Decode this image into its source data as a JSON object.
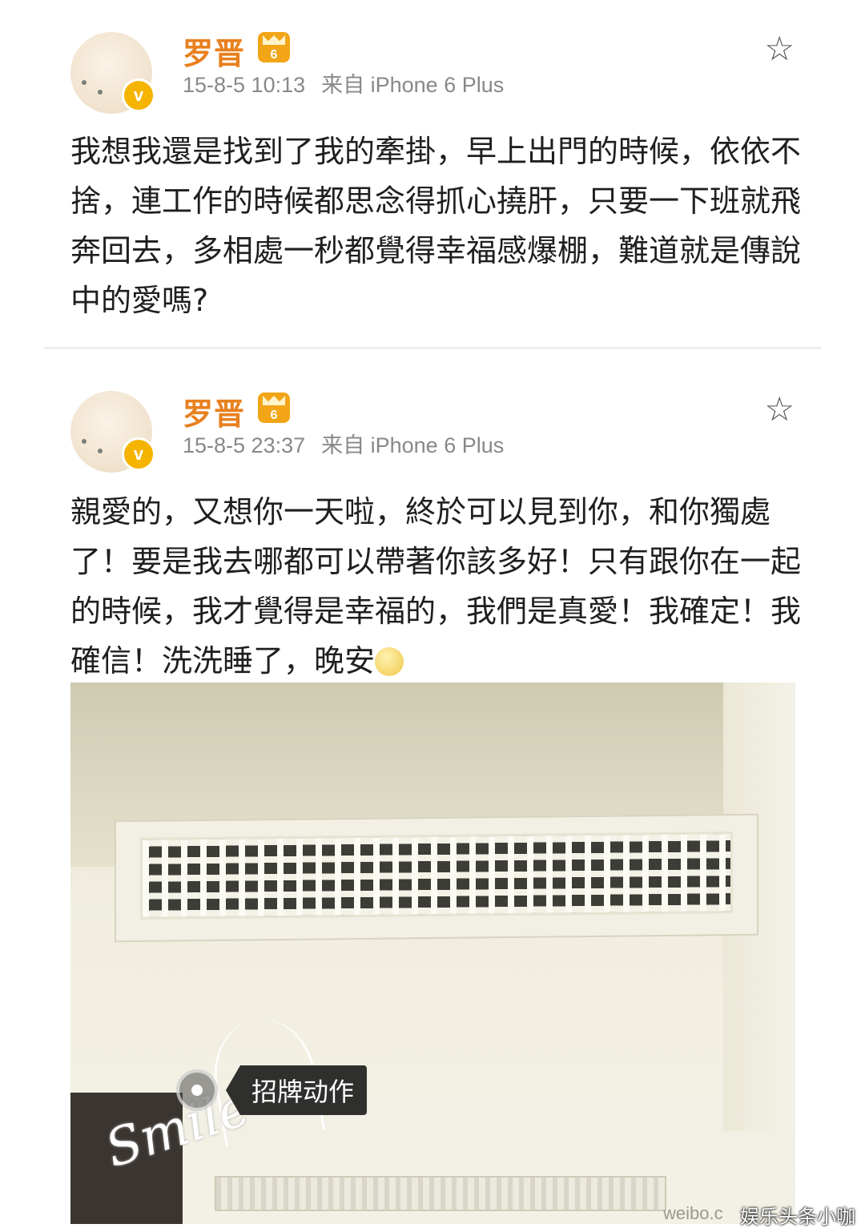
{
  "posts": [
    {
      "username": "罗晋",
      "level_badge": "6",
      "verified_badge": "v",
      "time": "15-8-5 10:13",
      "source": "来自 iPhone 6 Plus",
      "text": "我想我還是找到了我的牽掛，早上出門的時候，依依不捨，連工作的時候都思念得抓心撓肝，只要一下班就飛奔回去，多相處一秒都覺得幸福感爆棚，難道就是傳說中的愛嗎?"
    },
    {
      "username": "罗晋",
      "level_badge": "6",
      "verified_badge": "v",
      "time": "15-8-5 23:37",
      "source": "来自 iPhone 6 Plus",
      "text": "親愛的，又想你一天啦，終於可以見到你，和你獨處了！要是我去哪都可以帶著你該多好！只有跟你在一起的時候，我才覺得是幸福的，我們是真愛！我確定！我確信！洗洗睡了，晚安",
      "photo": {
        "tag_label": "招牌动作",
        "sticker_text": "Smile",
        "watermark": "weibo.c"
      }
    }
  ],
  "corner_watermark": "娱乐头条小咖",
  "icons": {
    "favorite": "star-outline-icon",
    "emoji": "sleepy-face-icon"
  },
  "colors": {
    "username": "#e8801f",
    "meta": "#888888",
    "badge": "#f5b400"
  }
}
